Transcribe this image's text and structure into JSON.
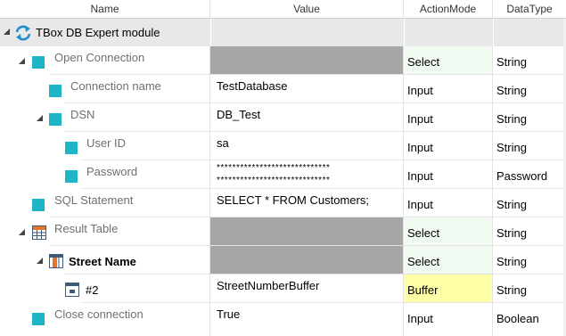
{
  "columns": {
    "name": "Name",
    "value": "Value",
    "action_mode": "ActionMode",
    "data_type": "DataType"
  },
  "module": {
    "label": "TBox DB Expert module"
  },
  "rows": [
    {
      "name": "Open Connection",
      "value": "",
      "action": "Select",
      "type": "String"
    },
    {
      "name": "Connection name",
      "value": "TestDatabase",
      "action": "Input",
      "type": "String"
    },
    {
      "name": "DSN",
      "value": "DB_Test",
      "action": "Input",
      "type": "String"
    },
    {
      "name": "User ID",
      "value": "sa",
      "action": "Input",
      "type": "String"
    },
    {
      "name": "Password",
      "value_line1": "*****************************",
      "value_line2": "*****************************",
      "action": "Input",
      "type": "Password"
    },
    {
      "name": "SQL Statement",
      "value": "SELECT * FROM Customers;",
      "action": "Input",
      "type": "String"
    },
    {
      "name": "Result Table",
      "value": "",
      "action": "Select",
      "type": "String"
    },
    {
      "name": "Street Name",
      "value": "",
      "action": "Select",
      "type": "String"
    },
    {
      "name": "#2",
      "value": "StreetNumberBuffer",
      "action": "Buffer",
      "type": "String"
    },
    {
      "name": "Close connection",
      "value": "True",
      "action": "Input",
      "type": "Boolean"
    }
  ],
  "colors": {
    "select_bg": "#f2fbf2",
    "buffer_bg": "#ffffa8",
    "empty_value_bg": "#a6a6a6",
    "module_row_bg": "#e8e8e8",
    "attribute_icon": "#1fb5c6"
  }
}
